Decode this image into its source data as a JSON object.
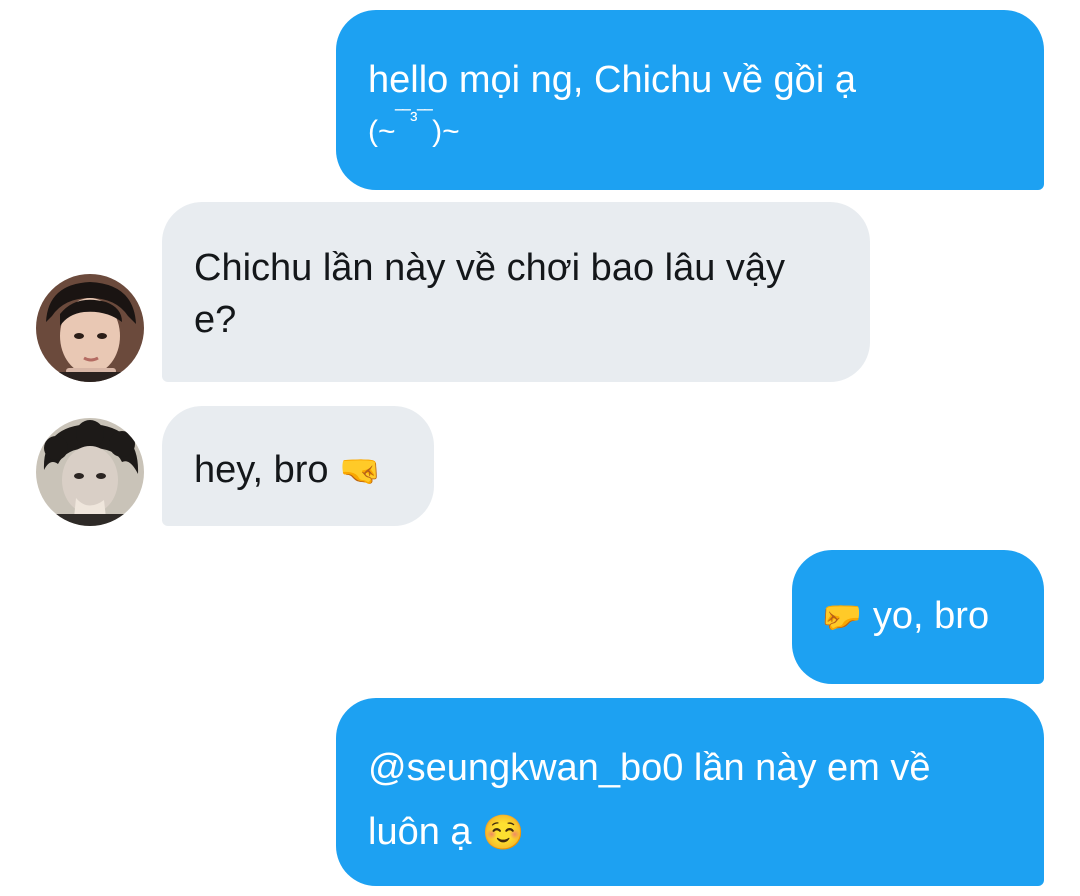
{
  "messages": [
    {
      "direction": "outgoing",
      "line1": "hello mọi ng, Chichu về gồi ạ",
      "line2_open": "(~",
      "line2_mid": "‾‾³‾‾",
      "line2_close": ")~"
    },
    {
      "direction": "incoming",
      "sender_avatar": "avatar-dark-hair",
      "text": "Chichu lần này về chơi bao lâu vậy e?"
    },
    {
      "direction": "incoming",
      "sender_avatar": "avatar-curly-hair",
      "text": "hey, bro",
      "emoji": "🤜"
    },
    {
      "direction": "outgoing",
      "emoji": "🤛",
      "text": "yo, bro"
    },
    {
      "direction": "outgoing",
      "text": "@seungkwan_bo0 lần này em về luôn ạ",
      "emoji": "☺️"
    }
  ],
  "colors": {
    "outgoing_bubble": "#1da1f2",
    "incoming_bubble": "#e8ecf0",
    "outgoing_text": "#ffffff",
    "incoming_text": "#14171a"
  }
}
